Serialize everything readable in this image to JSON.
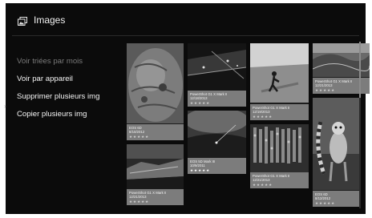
{
  "header": {
    "title": "Images",
    "icon": "photo-gallery-icon"
  },
  "menu": {
    "items": [
      {
        "label": "Voir triées par mois"
      },
      {
        "label": "Voir par appareil"
      },
      {
        "label": "Supprimer plusieurs img"
      },
      {
        "label": "Copier plusieurs img"
      }
    ]
  },
  "photos": [
    {
      "camera": "EOS 6D",
      "date": "8/10/2012",
      "stars": "★★★★★",
      "rating": 0
    },
    {
      "camera": "PowerShot G1 X Mark II",
      "date": "12/21/2013",
      "stars": "★★★★★",
      "rating": 0
    },
    {
      "camera": "PowerShot G1 X Mark II",
      "date": "12/18/2013",
      "stars": "★★★★★",
      "rating": 0
    },
    {
      "camera": "PowerShot G1 X Mark II",
      "date": "12/19/2013",
      "stars": "★★★★★",
      "rating": 0
    },
    {
      "camera": "EOS 5D Mark III",
      "date": "10/9/2011",
      "stars": "★★★★★",
      "rating": 5
    },
    {
      "camera": "PowerShot G1 X Mark II",
      "date": "12/21/2013",
      "stars": "★★★★★",
      "rating": 0
    },
    {
      "camera": "PowerShot G1 X Mark II",
      "date": "12/21/2013",
      "stars": "★★★★★",
      "rating": 0
    },
    {
      "camera": "EOS 6D",
      "date": "8/12/2012",
      "stars": "★★★★★",
      "rating": 0
    }
  ]
}
